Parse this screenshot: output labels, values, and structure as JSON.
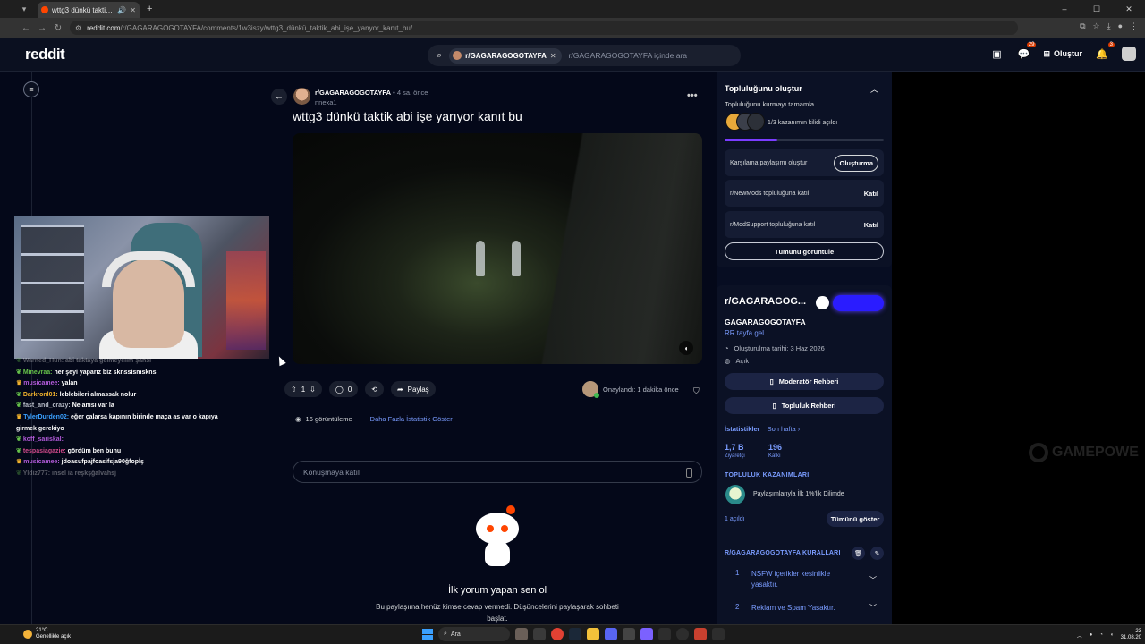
{
  "browser": {
    "tab_title": "wttg3 dünkü taktik abi işe y",
    "url_host": "reddit.com",
    "url_path": "/r/GAGARAGOGOTAYFA/comments/1w3iszy/wttg3_dünkü_taktik_abi_işe_yanyor_kanıt_bu/"
  },
  "header": {
    "logo": "reddit",
    "search_chip": "r/GAGARAGOGOTAYFA",
    "search_placeholder": "r/GAGARAGOGOTAYFA içinde ara",
    "chat_badge": "29",
    "create_label": "Oluştur",
    "notif_badge": "3"
  },
  "overlay": {
    "chat": [
      {
        "user": "Warned_Hun:",
        "msg": "abi taktaya gelmeyelim şahsi",
        "color": "#e8e8e8",
        "faded": true
      },
      {
        "user": "Minevraa:",
        "msg": "her şeyi yaparız biz sknssismskns",
        "color": "#66c14a"
      },
      {
        "user": "musicamee:",
        "msg": "yalan",
        "color": "#b15ad8"
      },
      {
        "user": "Darkronl01:",
        "msg": "leblebileri almassak nolur",
        "color": "#f0b12c"
      },
      {
        "user": "fast_and_crazy:",
        "msg": "Ne anısı var la",
        "color": "#b8bdc8"
      },
      {
        "user": "TylerDurden02:",
        "msg": "eğer çalarsa kapının birinde maça as var o kapıya girmek gerekiyo",
        "color": "#3aa0ff"
      },
      {
        "user": "koff_sariskal:",
        "msg": "",
        "color": "#b15ad8"
      },
      {
        "user": "tespasiagazie:",
        "msg": "gördüm ben bunu",
        "color": "#d04a8a"
      },
      {
        "user": "musicamee:",
        "msg": "jdoasufpajfoasifsja90ğfopİş",
        "color": "#b15ad8"
      },
      {
        "user": "Yldiz777:",
        "msg": "ınsel ia reşkşğalvahsj",
        "color": "#e8e8e8",
        "faded": true
      }
    ]
  },
  "post": {
    "subreddit": "r/GAGARAGOGOTAYFA",
    "time": "4 sa. önce",
    "author": "nnexa1",
    "title": "wttg3 dünkü taktik abi işe yarıyor kanıt bu",
    "votes": "1",
    "comments": "0",
    "share_label": "Paylaş",
    "approved_text": "Onaylandı: 1 dakika önce",
    "views": "16 görüntüleme",
    "more_stats": "Daha Fazla İstatistik Göster",
    "comment_placeholder": "Konuşmaya katıl",
    "first_comment_title": "İlk yorum yapan sen ol",
    "first_comment_desc": "Bu paylaşıma henüz kimse cevap vermedi. Düşüncelerini paylaşarak sohbeti başlat."
  },
  "sidebar": {
    "build": {
      "title": "Topluluğunu oluştur",
      "subtitle": "Topluluğunu kurmayı tamamla",
      "unlock_text": "1/3 kazanımın kilidi açıldı",
      "progress": 0.33,
      "tasks": [
        {
          "label": "Karşılama paylaşımı oluştur",
          "action": "Oluşturma"
        },
        {
          "label": "r/NewMods topluluğuna katıl",
          "action": "Katıl"
        },
        {
          "label": "r/ModSupport topluluğuna katıl",
          "action": "Katıl"
        }
      ],
      "view_all": "Tümünü görüntüle"
    },
    "community": {
      "name_short": "r/GAGARAGOG...",
      "name": "GAGARAGOGOTAYFA",
      "desc": "RR tayfa gel",
      "created": "Oluşturulma tarihi: 3 Haz 2026",
      "visibility": "Açık",
      "mod_guide": "Moderatör Rehberi",
      "community_guide": "Topluluk Rehberi",
      "stats_label": "İstatistikler",
      "stats_period": "Son hafta ›",
      "visitors_value": "1,7 B",
      "visitors_label": "Ziyaretçi",
      "contrib_value": "196",
      "contrib_label": "Katkı",
      "achievements_header": "TOPLULUK KAZANIMLARI",
      "achievement": "Paylaşımlarıyla İlk 1%'lik Dilimde",
      "achievements_open": "1 açıldı",
      "achievements_show": "Tümünü göster",
      "rules_header": "R/GAGARAGOGOTAYFA KURALLARI",
      "rules": [
        {
          "num": "1",
          "text": "NSFW içerikler kesinlikle yasaktır."
        },
        {
          "num": "2",
          "text": "Reklam ve Spam Yasaktır."
        }
      ]
    }
  },
  "watermark": "GAMEPOWE",
  "taskbar": {
    "temp": "21°C",
    "weather": "Genellikle açık",
    "search": "Ara",
    "time": "23",
    "date": "31.08.20"
  }
}
